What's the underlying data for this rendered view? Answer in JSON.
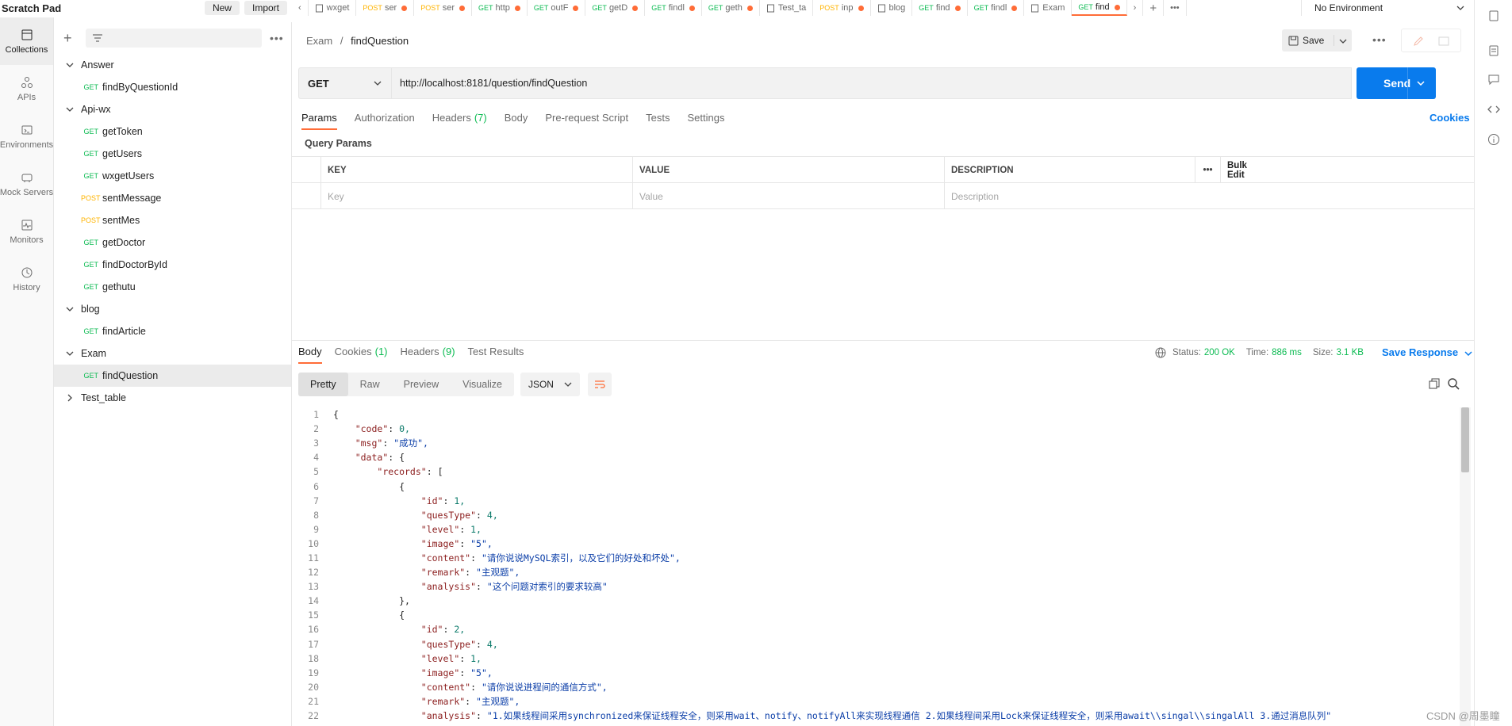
{
  "header": {
    "scratch_title": "Scratch Pad",
    "new_label": "New",
    "import_label": "Import"
  },
  "rail": [
    {
      "name": "collections",
      "label": "Collections",
      "icon": "collections-icon"
    },
    {
      "name": "apis",
      "label": "APIs",
      "icon": "apis-icon"
    },
    {
      "name": "environments",
      "label": "Environments",
      "icon": "environments-icon"
    },
    {
      "name": "mock-servers",
      "label": "Mock Servers",
      "icon": "mock-servers-icon"
    },
    {
      "name": "monitors",
      "label": "Monitors",
      "icon": "monitors-icon"
    },
    {
      "name": "history",
      "label": "History",
      "icon": "history-icon"
    }
  ],
  "tree": [
    {
      "label": "Answer",
      "type": "folder",
      "open": true
    },
    {
      "label": "findByQuestionId",
      "type": "request",
      "method": "GET"
    },
    {
      "label": "Api-wx",
      "type": "folder",
      "open": true
    },
    {
      "label": "getToken",
      "type": "request",
      "method": "GET"
    },
    {
      "label": "getUsers",
      "type": "request",
      "method": "GET"
    },
    {
      "label": "wxgetUsers",
      "type": "request",
      "method": "GET"
    },
    {
      "label": "sentMessage",
      "type": "request",
      "method": "POST"
    },
    {
      "label": "sentMes",
      "type": "request",
      "method": "POST"
    },
    {
      "label": "getDoctor",
      "type": "request",
      "method": "GET"
    },
    {
      "label": "findDoctorById",
      "type": "request",
      "method": "GET"
    },
    {
      "label": "gethutu",
      "type": "request",
      "method": "GET"
    },
    {
      "label": "blog",
      "type": "folder",
      "open": true
    },
    {
      "label": "findArticle",
      "type": "request",
      "method": "GET"
    },
    {
      "label": "Exam",
      "type": "folder",
      "open": true
    },
    {
      "label": "findQuestion",
      "type": "request",
      "method": "GET",
      "selected": true
    },
    {
      "label": "Test_table",
      "type": "folder",
      "open": false
    }
  ],
  "tabs": [
    {
      "method": "",
      "label": "wxget",
      "dot": false
    },
    {
      "method": "POST",
      "label": "ser",
      "dot": true
    },
    {
      "method": "POST",
      "label": "ser",
      "dot": true
    },
    {
      "method": "GET",
      "label": "http",
      "dot": true
    },
    {
      "method": "GET",
      "label": "outF",
      "dot": true
    },
    {
      "method": "GET",
      "label": "getD",
      "dot": true
    },
    {
      "method": "GET",
      "label": "findl",
      "dot": true
    },
    {
      "method": "GET",
      "label": "geth",
      "dot": true
    },
    {
      "method": "",
      "label": "Test_ta",
      "dot": false
    },
    {
      "method": "POST",
      "label": "inp",
      "dot": true
    },
    {
      "method": "",
      "label": "blog",
      "dot": false
    },
    {
      "method": "GET",
      "label": "find",
      "dot": true
    },
    {
      "method": "GET",
      "label": "findl",
      "dot": true
    },
    {
      "method": "",
      "label": "Exam",
      "dot": false
    },
    {
      "method": "GET",
      "label": "find",
      "dot": true,
      "active": true
    }
  ],
  "environment": "No Environment",
  "breadcrumb": {
    "parent": "Exam",
    "sep": "/",
    "current": "findQuestion"
  },
  "save_label": "Save",
  "request": {
    "method": "GET",
    "url": "http://localhost:8181/question/findQuestion",
    "send_label": "Send"
  },
  "req_tabs": [
    "Params",
    "Authorization",
    "Headers",
    "Body",
    "Pre-request Script",
    "Tests",
    "Settings"
  ],
  "headers_count": "(7)",
  "cookies_label": "Cookies",
  "query_params_label": "Query Params",
  "params_table": {
    "headers": [
      "KEY",
      "VALUE",
      "DESCRIPTION"
    ],
    "bulk_edit": "Bulk Edit",
    "placeholders": [
      "Key",
      "Value",
      "Description"
    ]
  },
  "response": {
    "tabs": [
      "Body",
      "Cookies",
      "Headers",
      "Test Results"
    ],
    "cookies_count": "(1)",
    "headers_count": "(9)",
    "status_label": "Status:",
    "status_value": "200 OK",
    "time_label": "Time:",
    "time_value": "886 ms",
    "size_label": "Size:",
    "size_value": "3.1 KB",
    "save_response": "Save Response",
    "views": [
      "Pretty",
      "Raw",
      "Preview",
      "Visualize"
    ],
    "format": "JSON"
  },
  "code_lines": [
    "{",
    "    \"code\": 0,",
    "    \"msg\": \"成功\",",
    "    \"data\": {",
    "        \"records\": [",
    "            {",
    "                \"id\": 1,",
    "                \"quesType\": 4,",
    "                \"level\": 1,",
    "                \"image\": \"5\",",
    "                \"content\": \"请你说说MySQL索引，以及它们的好处和坏处\",",
    "                \"remark\": \"主观题\",",
    "                \"analysis\": \"这个问题对索引的要求较高\"",
    "            },",
    "            {",
    "                \"id\": 2,",
    "                \"quesType\": 4,",
    "                \"level\": 1,",
    "                \"image\": \"5\",",
    "                \"content\": \"请你说说进程间的通信方式\",",
    "                \"remark\": \"主观题\",",
    "                \"analysis\": \"1.如果线程间采用synchronized来保证线程安全，则采用wait、notify、notifyAll来实现线程通信 2.如果线程间采用Lock来保证线程安全，则采用await\\\\singal\\\\singalAll 3.通过消息队列\"",
    "            },"
  ],
  "watermark": "CSDN @周墨瞳",
  "colors": {
    "accent": "#ff6c37",
    "send": "#097bed",
    "get": "#0cbb52",
    "post": "#ffb400"
  }
}
